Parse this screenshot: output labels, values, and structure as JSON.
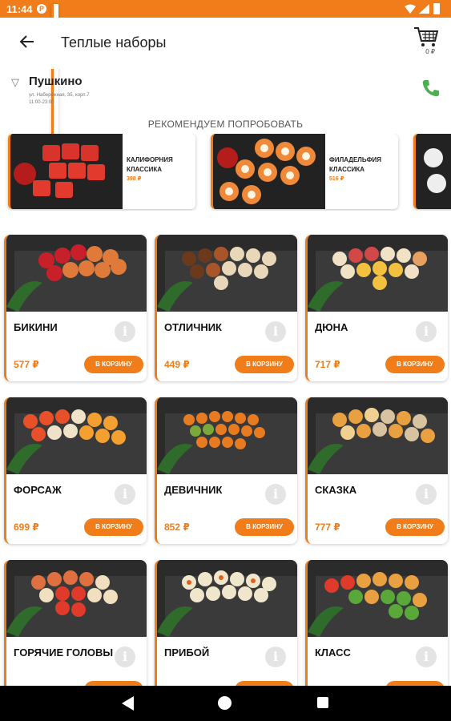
{
  "status_bar": {
    "time": "11:44"
  },
  "app_bar": {
    "title": "Теплые наборы",
    "cart_sum": "0 ₽"
  },
  "restaurant": {
    "name": "Пушкино",
    "address": "ул. Набережная, 35, корп.7",
    "hours": "11:00-23:00"
  },
  "recommend": {
    "heading": "РЕКОМЕНДУЕМ ПОПРОБОВАТЬ",
    "items": [
      {
        "name": "КАЛИФОРНИЯ КЛАССИКА",
        "price": "398 ₽"
      },
      {
        "name": "ФИЛАДЕЛЬФИЯ КЛАССИКА",
        "price": "516 ₽"
      }
    ]
  },
  "products": [
    {
      "name": "БИКИНИ",
      "price": "577 ₽",
      "button": "В КОРЗИНУ"
    },
    {
      "name": "ОТЛИЧНИК",
      "price": "449 ₽",
      "button": "В КОРЗИНУ"
    },
    {
      "name": "ДЮНА",
      "price": "717 ₽",
      "button": "В КОРЗИНУ"
    },
    {
      "name": "ФОРСАЖ",
      "price": "699 ₽",
      "button": "В КОРЗИНУ"
    },
    {
      "name": "ДЕВИЧНИК",
      "price": "852 ₽",
      "button": "В КОРЗИНУ"
    },
    {
      "name": "СКАЗКА",
      "price": "777 ₽",
      "button": "В КОРЗИНУ"
    },
    {
      "name": "ГОРЯЧИЕ ГОЛОВЫ",
      "price": "",
      "button": ""
    },
    {
      "name": "ПРИБОЙ",
      "price": "",
      "button": ""
    },
    {
      "name": "КЛАСС",
      "price": "",
      "button": ""
    }
  ],
  "colors": {
    "accent": "#f07d1a",
    "phone": "#4caf50"
  }
}
